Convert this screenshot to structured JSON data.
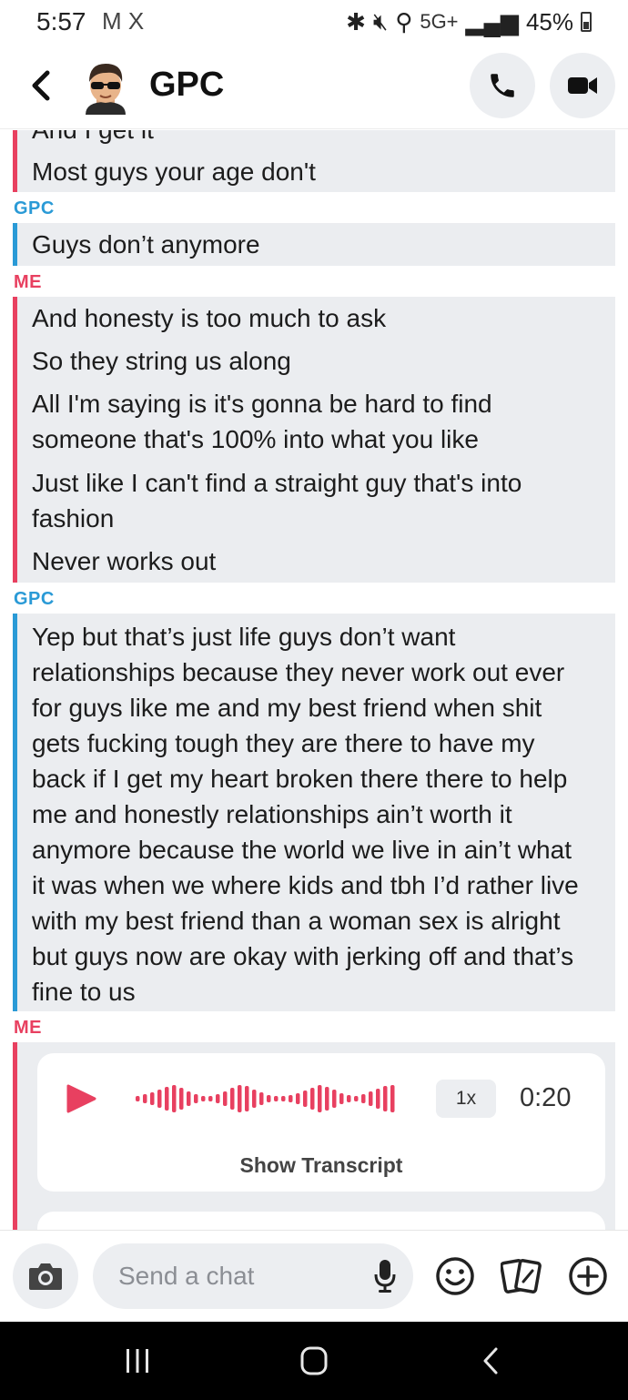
{
  "status_bar": {
    "time": "5:57",
    "left_icons": "M X",
    "network": "5G+",
    "battery": "45%"
  },
  "header": {
    "title": "GPC",
    "icons": [
      "back-chevron-icon",
      "bitmoji-avatar",
      "phone-icon",
      "video-camera-icon"
    ]
  },
  "chat": {
    "partial_top_text": "And I get it",
    "groups": [
      {
        "sender": "",
        "messages": [
          "Most guys your age don't"
        ]
      },
      {
        "sender": "GPC",
        "messages": [
          "Guys don’t anymore"
        ]
      },
      {
        "sender": "ME",
        "messages": [
          "And honesty is too much to ask",
          "So they string us along",
          "All I'm saying is it's gonna be hard to find",
          "someone that's 100% into what you like",
          "Just like I can't find a straight guy that's into",
          "fashion",
          "Never works out"
        ]
      },
      {
        "sender": "GPC",
        "messages": [
          "Yep but that’s just life guys don’t want",
          "relationships because they never work out ever",
          "for guys like me and my best friend when shit",
          "gets fucking tough they are there to have my",
          "back if I get my heart broken there there to help",
          "me and honestly relationships ain’t worth it",
          "anymore because the world we live in ain’t what",
          "it was when we where kids and tbh I’d rather live",
          "with my best friend than a woman sex is alright",
          "but guys now are okay with jerking off and that’s",
          "fine to us"
        ]
      },
      {
        "sender": "ME",
        "voice_note": {
          "speed": "1x",
          "duration": "0:20",
          "transcript_label": "Show Transcript"
        }
      }
    ]
  },
  "input_bar": {
    "placeholder": "Send a chat",
    "icons": [
      "camera-icon",
      "microphone-icon",
      "smiley-icon",
      "cards-icon",
      "plus-icon"
    ]
  },
  "nav_bar": {
    "icons": [
      "recent-apps-icon",
      "home-icon",
      "back-icon"
    ]
  },
  "colors": {
    "me": "#e84060",
    "gpc": "#2a9ad6",
    "bubble_bg": "#ebedf0"
  }
}
